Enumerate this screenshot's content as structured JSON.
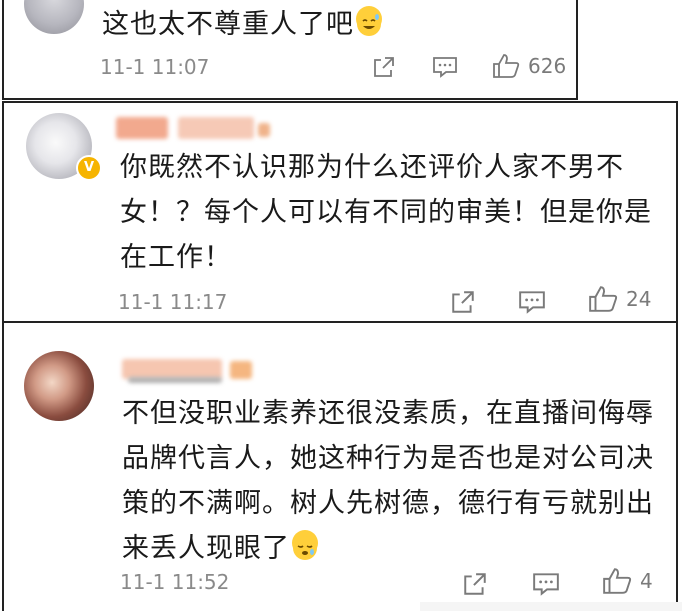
{
  "comments": [
    {
      "text": "这也太不尊重人了吧",
      "emoji": "sweat-smile-emoji",
      "time": "11-1 11:07",
      "likes": "626"
    },
    {
      "text": "你既然不认识那为什么还评价人家不男不女！？每个人可以有不同的审美！但是你是在工作！",
      "time": "11-1 11:17",
      "likes": "24"
    },
    {
      "text": "不但没职业素养还很没素质，在直播间侮辱品牌代言人，她这种行为是否也是对公司决策的不满啊。树人先树德，德行有亏就别出来丢人现眼了",
      "emoji": "sleepy-face-emoji",
      "time": "11-1 11:52",
      "likes": "4"
    }
  ],
  "icons": {
    "share": "share-icon",
    "reply": "comment-icon",
    "like": "thumbs-up-icon",
    "verified": "verified-badge-icon"
  },
  "colors": {
    "border": "#222222",
    "meta": "#8a8a8a",
    "badge": "#f6b400"
  }
}
